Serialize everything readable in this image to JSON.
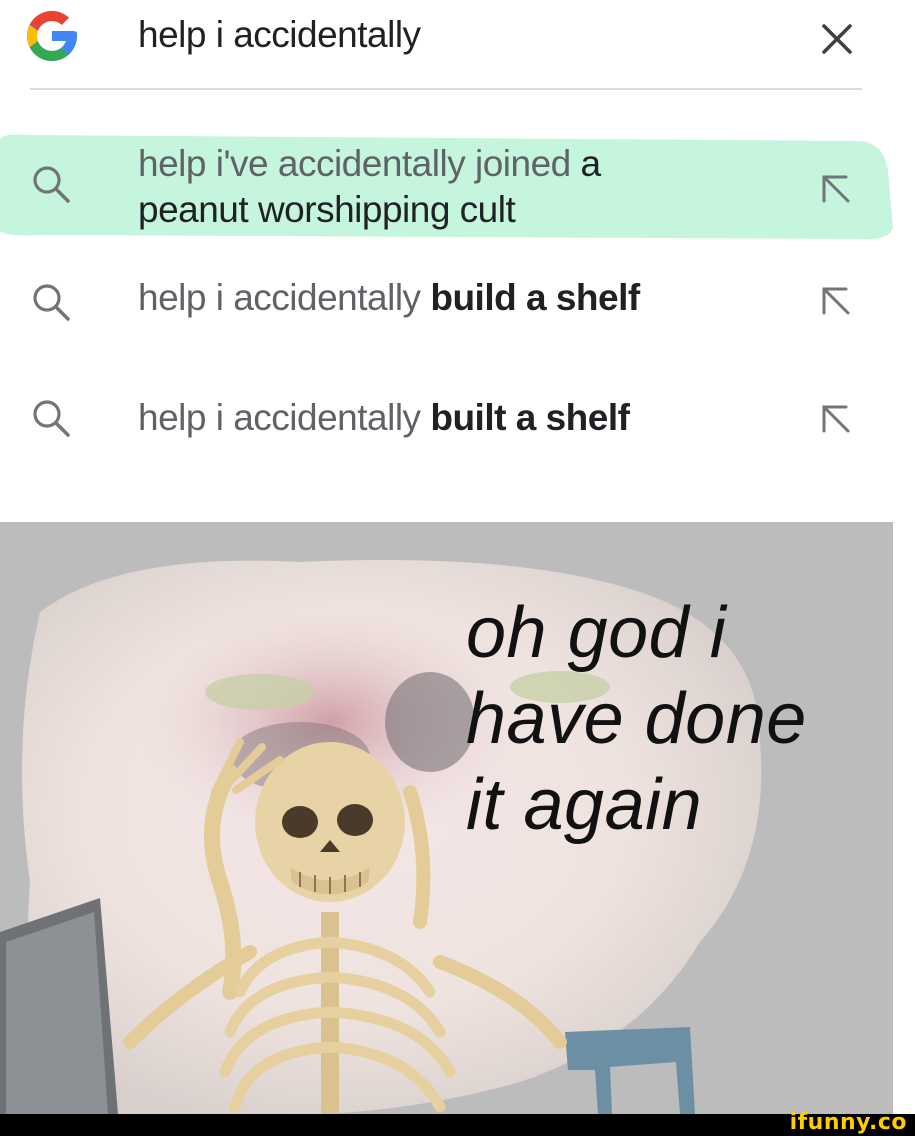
{
  "search": {
    "query": "help i accidentally",
    "clear_icon": "close-icon",
    "logo_icon": "google-g-logo"
  },
  "suggestions": [
    {
      "line1_prefix": "help i've accidentally joined ",
      "line1_rest": "a",
      "line2_prefix": "peanut worshipping cult",
      "line2_rest": "",
      "highlighted": true,
      "highlight_color": "#c5f5dd",
      "icon": "search-icon",
      "action_icon": "fill-query-arrow-icon"
    },
    {
      "prefix": "help i accidentally ",
      "rest": "build a shelf",
      "icon": "search-icon",
      "action_icon": "fill-query-arrow-icon"
    },
    {
      "prefix": "help i accidentally ",
      "rest": "built a shelf",
      "icon": "search-icon",
      "action_icon": "fill-query-arrow-icon"
    }
  ],
  "meme": {
    "caption": "oh god i\nhave done\nit again",
    "background_color": "#bcbcbc"
  },
  "watermark": "ifunny.co"
}
